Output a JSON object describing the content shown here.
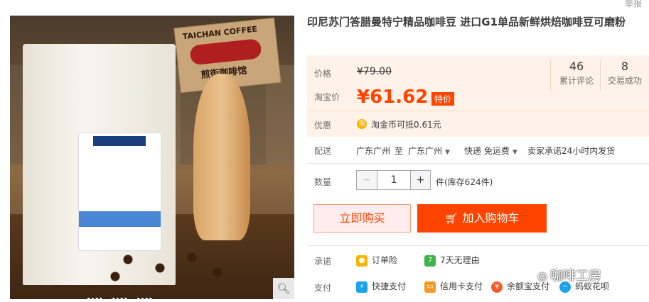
{
  "top": {
    "report": "举报"
  },
  "photo": {
    "sign_line1": "TAICHAN COFFEE",
    "sign_line2": "煎街咖啡馆"
  },
  "product": {
    "title": "印尼苏门答腊曼特宁精品咖啡豆 进口G1单品新鲜烘焙咖啡豆可磨粉"
  },
  "price": {
    "label_price": "价格",
    "original": "¥79.00",
    "label_taobao": "淘宝价",
    "current": "¥61.62",
    "tag": "特价",
    "stats": [
      {
        "value": "46",
        "label": "累计评论"
      },
      {
        "value": "8",
        "label": "交易成功"
      }
    ],
    "label_discount": "优惠",
    "coin_icon": "淘",
    "coin_text": "淘金币可抵0.61元"
  },
  "shipping": {
    "label": "配送",
    "from": "广东广州",
    "to_word": "至",
    "to": "广东广州",
    "method": "快递 免运费",
    "promise": "卖家承诺24小时内发货"
  },
  "quantity": {
    "label": "数量",
    "minus": "−",
    "value": "1",
    "plus": "+",
    "stock": "件(库存624件)"
  },
  "buttons": {
    "buy_now": "立即购买",
    "add_cart": "加入购物车"
  },
  "promise": {
    "label": "承诺",
    "items": [
      "订单险",
      "7天无理由"
    ]
  },
  "payment": {
    "label": "支付",
    "items": [
      "快捷支付",
      "信用卡支付",
      "余额宝支付",
      "蚂蚁花呗"
    ]
  },
  "watermark": {
    "text": "咖啡工房"
  },
  "colors": {
    "accent": "#ff4400",
    "price_bg": "#fff2e8",
    "coin": "#f7b500"
  }
}
